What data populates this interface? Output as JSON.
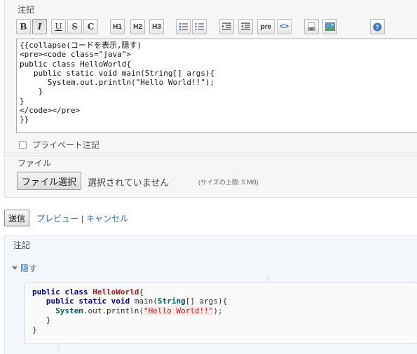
{
  "notes": {
    "legend": "注記",
    "toolbar": [
      {
        "name": "bold-button",
        "label": "B",
        "icon": "bold-icon"
      },
      {
        "name": "italic-button",
        "label": "I",
        "icon": "italic-icon"
      },
      {
        "name": "underline-button",
        "label": "U",
        "icon": "underline-icon"
      },
      {
        "name": "strikethrough-button",
        "label": "S",
        "icon": "strikethrough-icon"
      },
      {
        "name": "inline-code-button",
        "label": "C",
        "icon": "code-c-icon"
      },
      {
        "name": "heading1-button",
        "label": "H1",
        "icon": "heading1-icon"
      },
      {
        "name": "heading2-button",
        "label": "H2",
        "icon": "heading2-icon"
      },
      {
        "name": "heading3-button",
        "label": "H3",
        "icon": "heading3-icon"
      },
      {
        "name": "bullet-list-button",
        "label": "",
        "icon": "bullet-list-icon"
      },
      {
        "name": "numbered-list-button",
        "label": "",
        "icon": "numbered-list-icon"
      },
      {
        "name": "indent-button",
        "label": "",
        "icon": "indent-icon"
      },
      {
        "name": "outdent-button",
        "label": "",
        "icon": "outdent-icon"
      },
      {
        "name": "pre-button",
        "label": "pre",
        "icon": "pre-icon"
      },
      {
        "name": "code-highlight-button",
        "label": "<>",
        "icon": "code-brackets-icon"
      },
      {
        "name": "link-button",
        "label": "",
        "icon": "link-icon"
      },
      {
        "name": "image-button",
        "label": "",
        "icon": "image-icon"
      },
      {
        "name": "help-button",
        "label": "?",
        "icon": "help-icon"
      }
    ],
    "editor_text": "{{collapse(コードを表示,隠す)\n<pre><code class=\"java\">\npublic class HelloWorld{\n   public static void main(String[] args){\n      System.out.println(\"Hello World!!\");\n    }\n}\n</code></pre>\n}}",
    "private_label": "プライベート注記"
  },
  "file": {
    "legend": "ファイル",
    "choose_button": "ファイル選択",
    "no_file": "選択されていません",
    "max_size": "(サイズの上限: 5 MB)"
  },
  "actions": {
    "submit": "送信",
    "preview_link": "プレビュー",
    "separator": "|",
    "cancel_link": "キャンセル"
  },
  "preview": {
    "legend": "注記",
    "toggle_label": "隠す",
    "code": {
      "line1_kw": "public class",
      "line1_cls": "HelloWorld",
      "line1_end": "{",
      "line2_kw": "public static void",
      "line2_mid": "main(",
      "line2_type": "String",
      "line2_end": "[] args){",
      "line3_obj": "System",
      "line3_dot": ".out.println(",
      "line3_str": "\"Hello World!!\"",
      "line3_end": ");",
      "line4": "}",
      "line5": "}"
    }
  }
}
